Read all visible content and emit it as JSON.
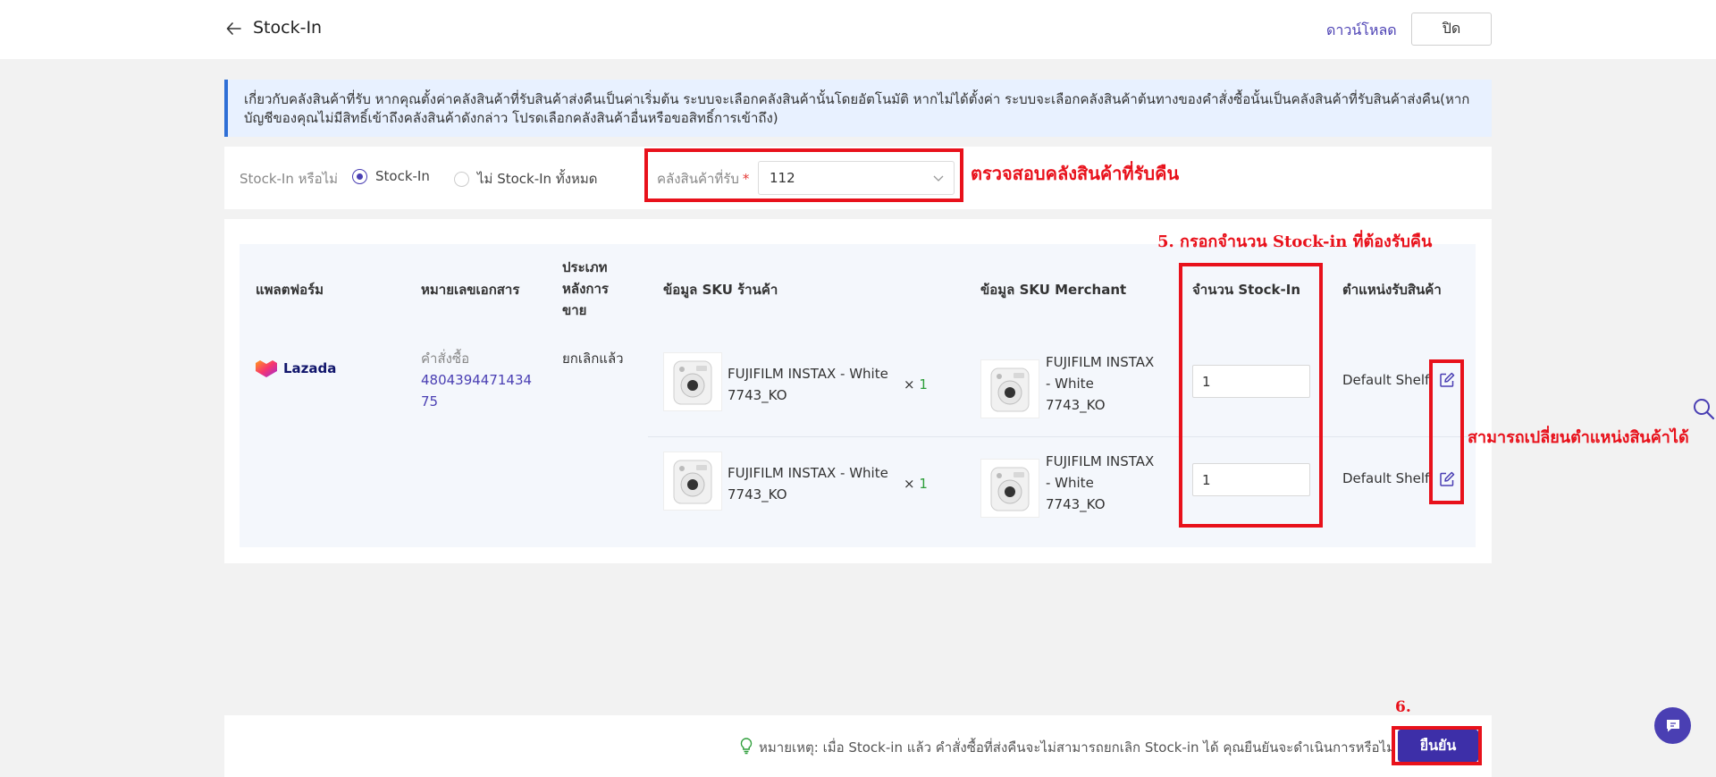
{
  "header": {
    "title": "Stock-In",
    "download_label": "ดาวน์โหลด",
    "close_label": "ปิด"
  },
  "info_banner": {
    "text": "เกี่ยวกับคลังสินค้าที่รับ หากคุณตั้งค่าคลังสินค้าที่รับสินค้าส่งคืนเป็นค่าเริ่มต้น ระบบจะเลือกคลังสินค้านั้นโดยอัตโนมัติ หากไม่ได้ตั้งค่า ระบบจะเลือกคลังสินค้าต้นทางของคำสั่งซื้อนั้นเป็นคลังสินค้าที่รับสินค้าส่งคืน(หากบัญชีของคุณไม่มีสิทธิ์เข้าถึงคลังสินค้าดังกล่าว โปรดเลือกคลังสินค้าอื่นหรือขอสิทธิ์การเข้าถึง)"
  },
  "filter": {
    "stockin_label": "Stock-In หรือไม่",
    "option_stockin": "Stock-In",
    "option_no_stockin": "ไม่ Stock-In ทั้งหมด",
    "selected_option": "Stock-In",
    "warehouse_label": "คลังสินค้าที่รับ",
    "required_mark": "*",
    "warehouse_value": "112"
  },
  "table": {
    "headers": {
      "platform": "แพลตฟอร์ม",
      "document": "หมายเลขเอกสาร",
      "aftersale_line1": "ประเภท",
      "aftersale_line2": "หลังการ",
      "aftersale_line3": "ขาย",
      "shop_sku": "ข้อมูล SKU ร้านค้า",
      "merchant_sku": "ข้อมูล SKU Merchant",
      "stockin_qty": "จำนวน Stock-In",
      "location": "ตำแหน่งรับสินค้า"
    },
    "order": {
      "platform": "Lazada",
      "doc_label": "คำสั่งซื้อ",
      "doc_number": "480439447143475",
      "aftersale_type": "ยกเลิกแล้ว"
    },
    "rows": [
      {
        "shop_sku_line1": "FUJIFILM INSTAX - White",
        "shop_sku_line2": "7743_KO",
        "qty_prefix": "×",
        "qty": "1",
        "merchant_sku_line1": "FUJIFILM INSTAX",
        "merchant_sku_line2": "- White",
        "merchant_sku_line3": "7743_KO",
        "stockin_value": "1",
        "shelf": "Default Shelf"
      },
      {
        "shop_sku_line1": "FUJIFILM INSTAX - White",
        "shop_sku_line2": "7743_KO",
        "qty_prefix": "×",
        "qty": "1",
        "merchant_sku_line1": "FUJIFILM INSTAX",
        "merchant_sku_line2": "- White",
        "merchant_sku_line3": "7743_KO",
        "stockin_value": "1",
        "shelf": "Default Shelf"
      }
    ]
  },
  "footer": {
    "note": "หมายเหตุ: เมื่อ Stock-in แล้ว คำสั่งซื้อที่ส่งคืนจะไม่สามารถยกเลิก Stock-in ได้ คุณยืนยันจะดำเนินการหรือไม่",
    "confirm_label": "ยืนยัน"
  },
  "annotations": {
    "check_warehouse": "ตรวจสอบคลังสินค้าที่รับคืน",
    "step5": "5. กรอกจำนวน Stock-in ที่ต้องรับคืน",
    "change_location": "สามารถเปลี่ยนตำแหน่งสินค้าได้",
    "step6": "6."
  },
  "colors": {
    "accent": "#4a3fb3",
    "annotation_red": "#e8111b",
    "banner_bg": "#e8f1ff",
    "table_bg": "#f4f7fc"
  }
}
